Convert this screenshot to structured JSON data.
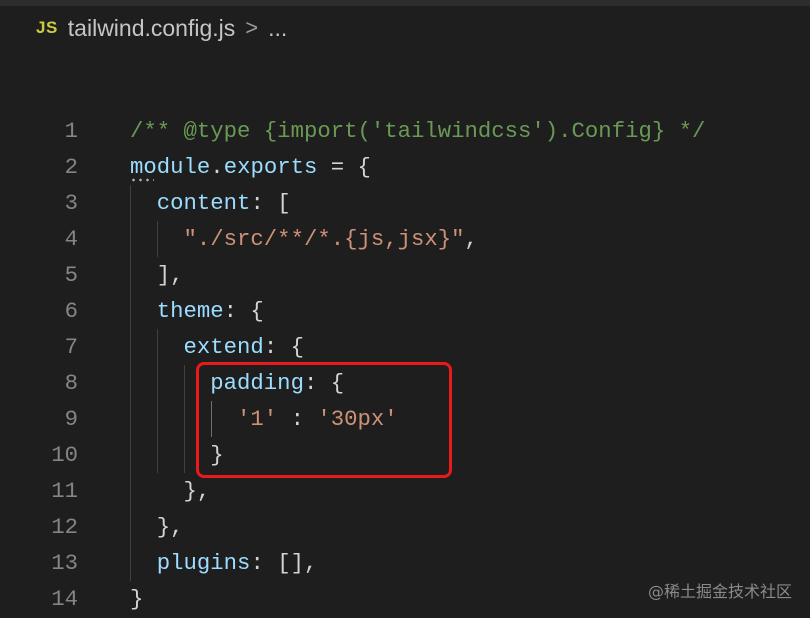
{
  "breadcrumb": {
    "file_icon": "JS",
    "file_name": "tailwind.config.js",
    "separator": ">",
    "more": "..."
  },
  "editor": {
    "lines": [
      {
        "n": "1",
        "tokens": [
          [
            "/** @type {import('tailwindcss').Config} */",
            "c-comment"
          ]
        ]
      },
      {
        "n": "2",
        "tokens": [
          [
            "module",
            "c-var"
          ],
          [
            ".",
            "c-punct"
          ],
          [
            "exports",
            "c-var"
          ],
          [
            " = {",
            "c-punct"
          ]
        ]
      },
      {
        "n": "3",
        "tokens": [
          [
            "  content",
            "c-prop"
          ],
          [
            ": [",
            "c-punct"
          ]
        ]
      },
      {
        "n": "4",
        "tokens": [
          [
            "    \"./src/**/*.{js,jsx}\"",
            "c-str"
          ],
          [
            ",",
            "c-punct"
          ]
        ]
      },
      {
        "n": "5",
        "tokens": [
          [
            "  ],",
            "c-punct"
          ]
        ]
      },
      {
        "n": "6",
        "tokens": [
          [
            "  theme",
            "c-prop"
          ],
          [
            ": {",
            "c-punct"
          ]
        ]
      },
      {
        "n": "7",
        "tokens": [
          [
            "    extend",
            "c-prop"
          ],
          [
            ": {",
            "c-punct"
          ]
        ]
      },
      {
        "n": "8",
        "tokens": [
          [
            "      padding",
            "c-prop"
          ],
          [
            ": {",
            "c-punct"
          ]
        ]
      },
      {
        "n": "9",
        "tokens": [
          [
            "        '1'",
            "c-str"
          ],
          [
            " : ",
            "c-punct"
          ],
          [
            "'30px'",
            "c-str"
          ]
        ]
      },
      {
        "n": "10",
        "tokens": [
          [
            "      }",
            "c-punct"
          ]
        ]
      },
      {
        "n": "11",
        "tokens": [
          [
            "    },",
            "c-punct"
          ]
        ]
      },
      {
        "n": "12",
        "tokens": [
          [
            "  },",
            "c-punct"
          ]
        ]
      },
      {
        "n": "13",
        "tokens": [
          [
            "  plugins",
            "c-prop"
          ],
          [
            ": [],",
            "c-punct"
          ]
        ]
      },
      {
        "n": "14",
        "tokens": [
          [
            "}",
            "c-punct"
          ]
        ]
      }
    ]
  },
  "watermark": "@稀土掘金技术社区",
  "colors": {
    "background": "#1e1e1e",
    "highlight_border": "#e81a1a",
    "comment": "#6a9955",
    "property": "#9cdcfe",
    "string": "#ce9178"
  }
}
